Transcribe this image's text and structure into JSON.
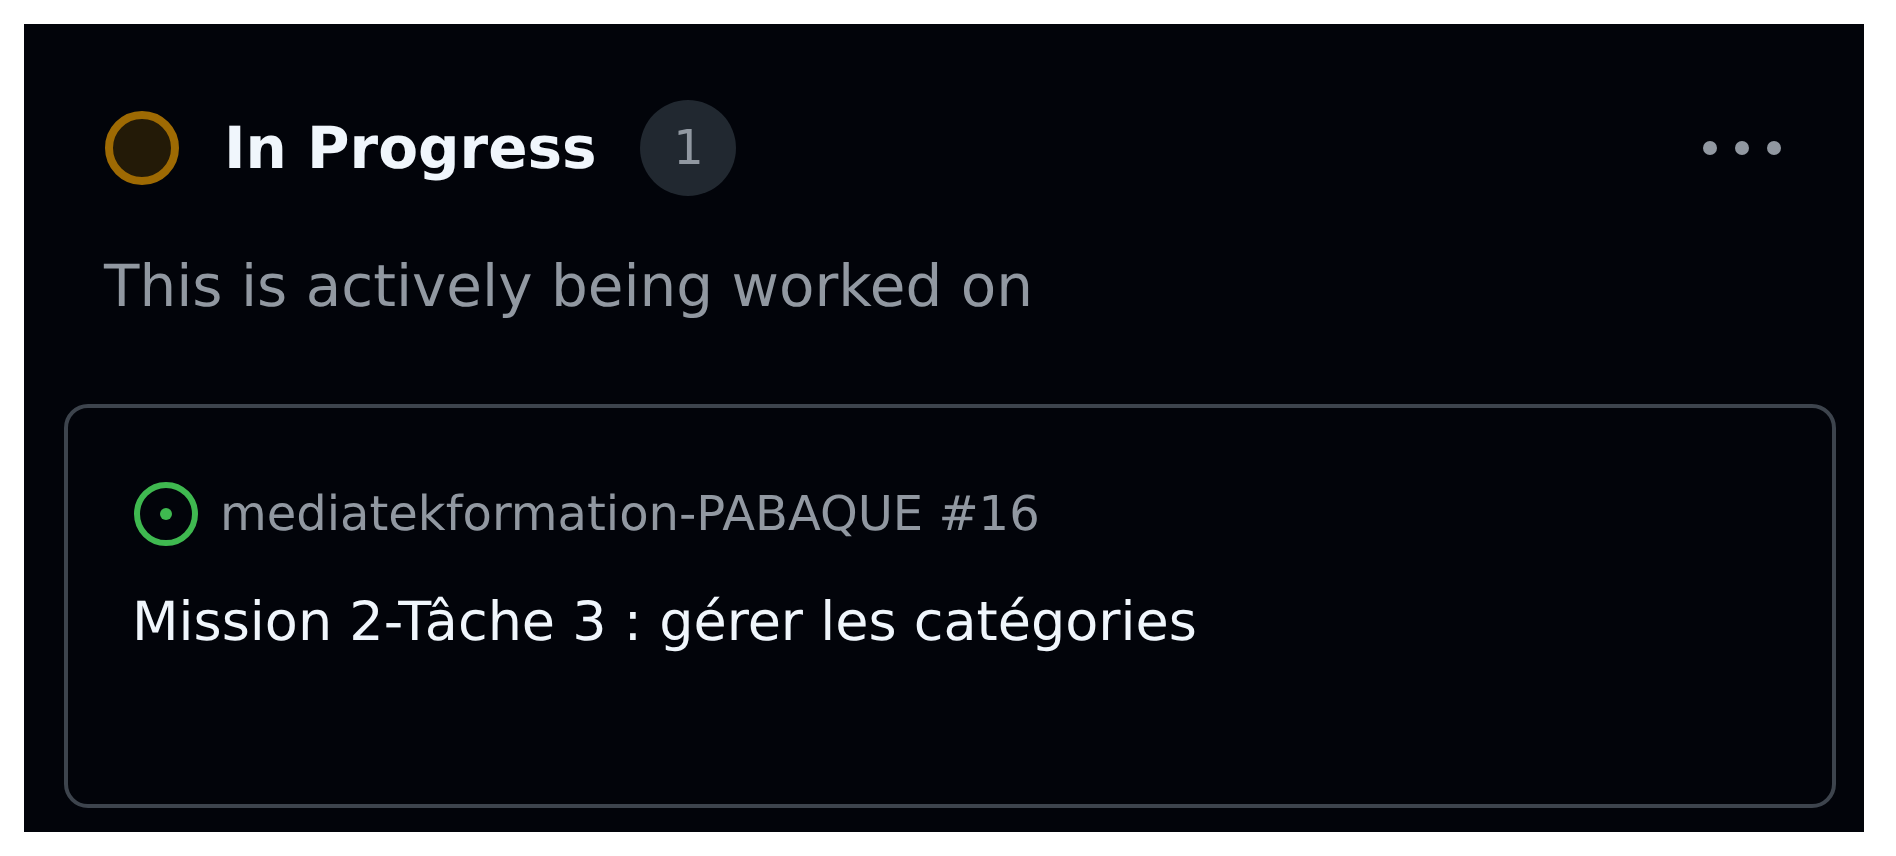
{
  "column": {
    "title": "In Progress",
    "count": "1",
    "description": "This is actively being worked on"
  },
  "cards": [
    {
      "repository": "mediatekformation-PABAQUE #16",
      "title": "Mission 2-Tâche 3 : gérer les catégories"
    }
  ]
}
